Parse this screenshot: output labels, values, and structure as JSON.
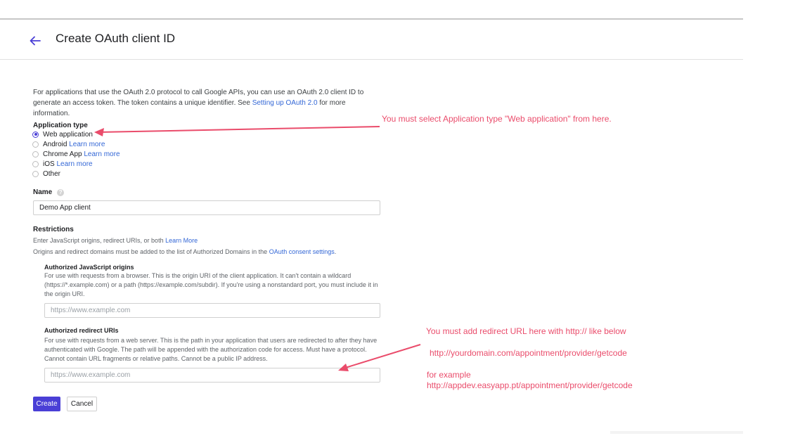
{
  "header": {
    "title": "Create OAuth client ID"
  },
  "intro": {
    "text_before": "For applications that use the OAuth 2.0 protocol to call Google APIs, you can use an OAuth 2.0 client ID to generate an access token. The token contains a unique identifier. See ",
    "link": "Setting up OAuth 2.0",
    "text_after": " for more information."
  },
  "application_type": {
    "label": "Application type",
    "options": [
      {
        "label": "Web application",
        "link": "",
        "selected": true
      },
      {
        "label": "Android",
        "link": "Learn more",
        "selected": false
      },
      {
        "label": "Chrome App",
        "link": "Learn more",
        "selected": false
      },
      {
        "label": "iOS",
        "link": "Learn more",
        "selected": false
      },
      {
        "label": "Other",
        "link": "",
        "selected": false
      }
    ]
  },
  "name": {
    "label": "Name",
    "help_icon": "help-circle-icon",
    "value": "Demo App client"
  },
  "restrictions": {
    "title": "Restrictions",
    "line1_text": "Enter JavaScript origins, redirect URIs, or both ",
    "line1_link": "Learn More",
    "line2_text": "Origins and redirect domains must be added to the list of Authorized Domains in the ",
    "line2_link": "OAuth consent settings",
    "line2_end": "."
  },
  "js_origins": {
    "title": "Authorized JavaScript origins",
    "desc": "For use with requests from a browser. This is the origin URI of the client application. It can't contain a wildcard (https://*.example.com) or a path (https://example.com/subdir). If you're using a nonstandard port, you must include it in the origin URI.",
    "placeholder": "https://www.example.com"
  },
  "redirect_uris": {
    "title": "Authorized redirect URIs",
    "desc": "For use with requests from a web server. This is the path in your application that users are redirected to after they have authenticated with Google. The path will be appended with the authorization code for access. Must have a protocol. Cannot contain URL fragments or relative paths. Cannot be a public IP address.",
    "placeholder": "https://www.example.com"
  },
  "buttons": {
    "create": "Create",
    "cancel": "Cancel"
  },
  "annotations": {
    "note1": "You must select Application type \"Web application\" from here.",
    "note2": "You must add redirect URL here with http:// like below",
    "note3": "http://yourdomain.com/appointment/provider/getcode",
    "note4": "for example",
    "note5": "http://appdev.easyapp.pt/appointment/provider/getcode"
  },
  "colors": {
    "accent": "#4a3fd6",
    "link": "#3367d6",
    "annotation": "#ea4c6b"
  },
  "icons": {
    "back": "arrow-left-icon"
  }
}
